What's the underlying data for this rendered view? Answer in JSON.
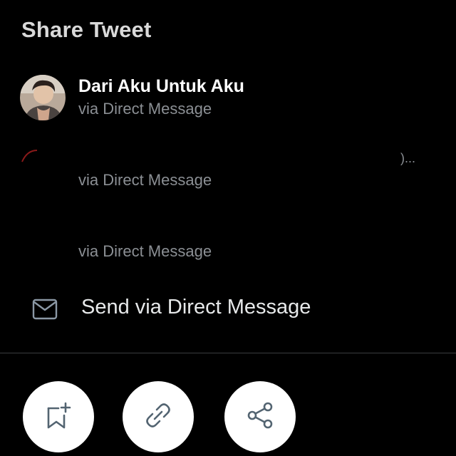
{
  "sheet": {
    "title": "Share Tweet"
  },
  "recipients": [
    {
      "name": "Dari Aku Untuk Aku",
      "via": "via Direct Message",
      "avatar_icon": "user-avatar-icon"
    },
    {
      "name": "",
      "via": "via Direct Message",
      "truncated": ")..."
    },
    {
      "name": "",
      "via": "via Direct Message"
    }
  ],
  "direct_message": {
    "label": "Send via Direct Message",
    "icon": "envelope-icon"
  },
  "actions": [
    {
      "name": "bookmark",
      "icon": "bookmark-plus-icon"
    },
    {
      "name": "copy-link",
      "icon": "link-icon"
    },
    {
      "name": "share",
      "icon": "share-icon"
    }
  ],
  "colors": {
    "background": "#000000",
    "primary_text": "#e7e9ea",
    "secondary_text": "#8b8f94",
    "button_bg": "#ffffff",
    "icon_stroke": "#536471"
  }
}
